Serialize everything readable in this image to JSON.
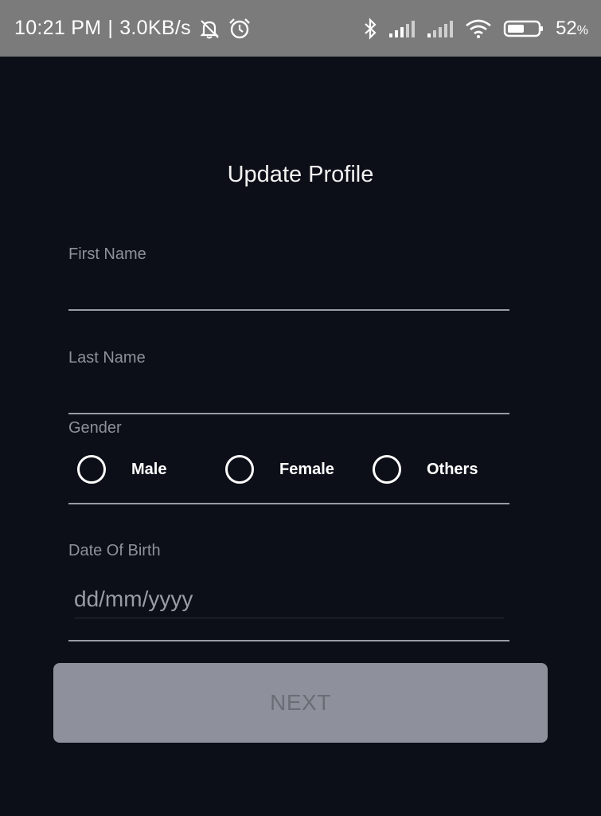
{
  "status_bar": {
    "time": "10:21 PM",
    "separator": "|",
    "network_speed": "3.0KB/s",
    "battery_percent": "52",
    "battery_unit": "%",
    "icons": [
      "notifications-muted-icon",
      "alarm-icon",
      "bluetooth-icon",
      "signal-icon",
      "signal-icon",
      "wifi-icon",
      "battery-icon"
    ]
  },
  "page": {
    "title": "Update Profile"
  },
  "form": {
    "first_name": {
      "label": "First Name",
      "value": ""
    },
    "last_name": {
      "label": "Last Name",
      "value": ""
    },
    "gender": {
      "label": "Gender",
      "options": [
        "Male",
        "Female",
        "Others"
      ],
      "selected": null
    },
    "dob": {
      "label": "Date Of Birth",
      "placeholder": "dd/mm/yyyy",
      "value": ""
    }
  },
  "actions": {
    "next_label": "NEXT"
  },
  "colors": {
    "background": "#0c0f17",
    "status_bar": "#7b7b7b",
    "button_disabled": "#8e919b",
    "label": "#8e909a"
  }
}
